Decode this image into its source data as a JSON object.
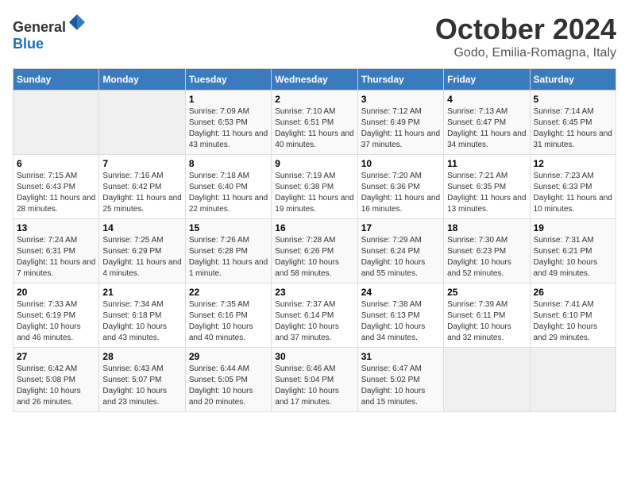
{
  "header": {
    "logo_general": "General",
    "logo_blue": "Blue",
    "month": "October 2024",
    "location": "Godo, Emilia-Romagna, Italy"
  },
  "days_of_week": [
    "Sunday",
    "Monday",
    "Tuesday",
    "Wednesday",
    "Thursday",
    "Friday",
    "Saturday"
  ],
  "weeks": [
    [
      {
        "day": "",
        "empty": true
      },
      {
        "day": "",
        "empty": true
      },
      {
        "day": "1",
        "sunrise": "Sunrise: 7:09 AM",
        "sunset": "Sunset: 6:53 PM",
        "daylight": "Daylight: 11 hours and 43 minutes."
      },
      {
        "day": "2",
        "sunrise": "Sunrise: 7:10 AM",
        "sunset": "Sunset: 6:51 PM",
        "daylight": "Daylight: 11 hours and 40 minutes."
      },
      {
        "day": "3",
        "sunrise": "Sunrise: 7:12 AM",
        "sunset": "Sunset: 6:49 PM",
        "daylight": "Daylight: 11 hours and 37 minutes."
      },
      {
        "day": "4",
        "sunrise": "Sunrise: 7:13 AM",
        "sunset": "Sunset: 6:47 PM",
        "daylight": "Daylight: 11 hours and 34 minutes."
      },
      {
        "day": "5",
        "sunrise": "Sunrise: 7:14 AM",
        "sunset": "Sunset: 6:45 PM",
        "daylight": "Daylight: 11 hours and 31 minutes."
      }
    ],
    [
      {
        "day": "6",
        "sunrise": "Sunrise: 7:15 AM",
        "sunset": "Sunset: 6:43 PM",
        "daylight": "Daylight: 11 hours and 28 minutes."
      },
      {
        "day": "7",
        "sunrise": "Sunrise: 7:16 AM",
        "sunset": "Sunset: 6:42 PM",
        "daylight": "Daylight: 11 hours and 25 minutes."
      },
      {
        "day": "8",
        "sunrise": "Sunrise: 7:18 AM",
        "sunset": "Sunset: 6:40 PM",
        "daylight": "Daylight: 11 hours and 22 minutes."
      },
      {
        "day": "9",
        "sunrise": "Sunrise: 7:19 AM",
        "sunset": "Sunset: 6:38 PM",
        "daylight": "Daylight: 11 hours and 19 minutes."
      },
      {
        "day": "10",
        "sunrise": "Sunrise: 7:20 AM",
        "sunset": "Sunset: 6:36 PM",
        "daylight": "Daylight: 11 hours and 16 minutes."
      },
      {
        "day": "11",
        "sunrise": "Sunrise: 7:21 AM",
        "sunset": "Sunset: 6:35 PM",
        "daylight": "Daylight: 11 hours and 13 minutes."
      },
      {
        "day": "12",
        "sunrise": "Sunrise: 7:23 AM",
        "sunset": "Sunset: 6:33 PM",
        "daylight": "Daylight: 11 hours and 10 minutes."
      }
    ],
    [
      {
        "day": "13",
        "sunrise": "Sunrise: 7:24 AM",
        "sunset": "Sunset: 6:31 PM",
        "daylight": "Daylight: 11 hours and 7 minutes."
      },
      {
        "day": "14",
        "sunrise": "Sunrise: 7:25 AM",
        "sunset": "Sunset: 6:29 PM",
        "daylight": "Daylight: 11 hours and 4 minutes."
      },
      {
        "day": "15",
        "sunrise": "Sunrise: 7:26 AM",
        "sunset": "Sunset: 6:28 PM",
        "daylight": "Daylight: 11 hours and 1 minute."
      },
      {
        "day": "16",
        "sunrise": "Sunrise: 7:28 AM",
        "sunset": "Sunset: 6:26 PM",
        "daylight": "Daylight: 10 hours and 58 minutes."
      },
      {
        "day": "17",
        "sunrise": "Sunrise: 7:29 AM",
        "sunset": "Sunset: 6:24 PM",
        "daylight": "Daylight: 10 hours and 55 minutes."
      },
      {
        "day": "18",
        "sunrise": "Sunrise: 7:30 AM",
        "sunset": "Sunset: 6:23 PM",
        "daylight": "Daylight: 10 hours and 52 minutes."
      },
      {
        "day": "19",
        "sunrise": "Sunrise: 7:31 AM",
        "sunset": "Sunset: 6:21 PM",
        "daylight": "Daylight: 10 hours and 49 minutes."
      }
    ],
    [
      {
        "day": "20",
        "sunrise": "Sunrise: 7:33 AM",
        "sunset": "Sunset: 6:19 PM",
        "daylight": "Daylight: 10 hours and 46 minutes."
      },
      {
        "day": "21",
        "sunrise": "Sunrise: 7:34 AM",
        "sunset": "Sunset: 6:18 PM",
        "daylight": "Daylight: 10 hours and 43 minutes."
      },
      {
        "day": "22",
        "sunrise": "Sunrise: 7:35 AM",
        "sunset": "Sunset: 6:16 PM",
        "daylight": "Daylight: 10 hours and 40 minutes."
      },
      {
        "day": "23",
        "sunrise": "Sunrise: 7:37 AM",
        "sunset": "Sunset: 6:14 PM",
        "daylight": "Daylight: 10 hours and 37 minutes."
      },
      {
        "day": "24",
        "sunrise": "Sunrise: 7:38 AM",
        "sunset": "Sunset: 6:13 PM",
        "daylight": "Daylight: 10 hours and 34 minutes."
      },
      {
        "day": "25",
        "sunrise": "Sunrise: 7:39 AM",
        "sunset": "Sunset: 6:11 PM",
        "daylight": "Daylight: 10 hours and 32 minutes."
      },
      {
        "day": "26",
        "sunrise": "Sunrise: 7:41 AM",
        "sunset": "Sunset: 6:10 PM",
        "daylight": "Daylight: 10 hours and 29 minutes."
      }
    ],
    [
      {
        "day": "27",
        "sunrise": "Sunrise: 6:42 AM",
        "sunset": "Sunset: 5:08 PM",
        "daylight": "Daylight: 10 hours and 26 minutes."
      },
      {
        "day": "28",
        "sunrise": "Sunrise: 6:43 AM",
        "sunset": "Sunset: 5:07 PM",
        "daylight": "Daylight: 10 hours and 23 minutes."
      },
      {
        "day": "29",
        "sunrise": "Sunrise: 6:44 AM",
        "sunset": "Sunset: 5:05 PM",
        "daylight": "Daylight: 10 hours and 20 minutes."
      },
      {
        "day": "30",
        "sunrise": "Sunrise: 6:46 AM",
        "sunset": "Sunset: 5:04 PM",
        "daylight": "Daylight: 10 hours and 17 minutes."
      },
      {
        "day": "31",
        "sunrise": "Sunrise: 6:47 AM",
        "sunset": "Sunset: 5:02 PM",
        "daylight": "Daylight: 10 hours and 15 minutes."
      },
      {
        "day": "",
        "empty": true
      },
      {
        "day": "",
        "empty": true
      }
    ]
  ]
}
